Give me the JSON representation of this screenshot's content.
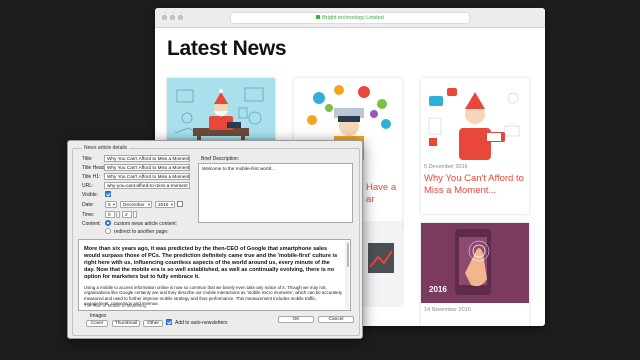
{
  "browser": {
    "url": "Bright technology Limited",
    "page_title": "Latest News"
  },
  "cards": [
    {
      "date": "",
      "title": ""
    },
    {
      "date": "",
      "title": "Have a"
    },
    {
      "date": "5 December 2016",
      "title": "Why You Can't Afford to Miss a Moment..."
    },
    {
      "date": "14 November 2016",
      "title": "",
      "image_year": "2016"
    }
  ],
  "card2_title_line2": "ar",
  "dialog": {
    "group_label": "News article details",
    "labels": {
      "title": "Title:",
      "title_head": "Title Head:",
      "title_h1": "Title H1:",
      "url": "URL:",
      "visible": "Visible:",
      "date": "Date:",
      "time": "Time:",
      "content": "Content:",
      "brief": "Brief Description:",
      "images": "Images"
    },
    "fields": {
      "title": "Why You Can't Afford to Miss a Moment...",
      "title_head": "Why You Can't Afford to Miss a Moment...",
      "title_h1": "Why You Can't Afford to Miss a Moment...",
      "url": "why-you-cant-afford-to-miss-a-moment",
      "day": "5",
      "month": "December",
      "year": "2016",
      "hour": "0",
      "minute": "2",
      "brief": "Welcome to the mobile-first world..."
    },
    "radios": {
      "custom": "custom news article content:",
      "redirect": "redirect to another page:"
    },
    "editor": {
      "bold": "More than six years ago, it was predicted by the then-CEO of Google that smartphone sales would surpass those of PCs. The prediction definitely came true and the 'mobile-first' culture is right here with us, influencing countless aspects of the world around us, every minute of the day. Now that the mobile era is so well established, as well as continually evolving, there is no option for marketers but to fully embrace it.",
      "body": "Using a mobile to access information online is now so common that we barely even take any notice of it. Though we may not, organisations like Google certainly are and they describe our mobile interactions as 'mobile micro moments', which can be accurately measured and used to further improve mobile strategy and thus performance. This measurement includes mobile traffic, engagement, conversion and revenue.",
      "foot": "The Rise of Mobile to Marketing"
    },
    "buttons": {
      "cover": "Cover",
      "thumbnail": "Thumbnail",
      "other": "Other",
      "ok": "OK",
      "cancel": "Cancel"
    },
    "auto_newsletters": "Add to auto-newsletters"
  },
  "colors": {
    "accent_red": "#e8483b",
    "secure_green": "#3cab3c",
    "checkbox_blue": "#3a7bf0"
  }
}
